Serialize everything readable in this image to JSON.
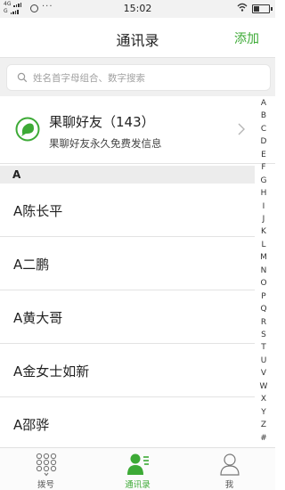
{
  "status_bar": {
    "network_1": "4G",
    "network_2": "G",
    "time": "15:02",
    "dots": "···"
  },
  "header": {
    "title": "通讯录",
    "add_label": "添加"
  },
  "search": {
    "placeholder": "姓名首字母组合、数字搜索"
  },
  "friends_card": {
    "title": "果聊好友（143）",
    "subtitle": "果聊好友永久免费发信息"
  },
  "index_letters": [
    "A",
    "B",
    "C",
    "D",
    "E",
    "F",
    "G",
    "H",
    "I",
    "J",
    "K",
    "L",
    "M",
    "N",
    "O",
    "P",
    "Q",
    "R",
    "S",
    "T",
    "U",
    "V",
    "W",
    "X",
    "Y",
    "Z",
    "#"
  ],
  "section": {
    "letter": "A"
  },
  "contacts": [
    {
      "name": "A陈长平"
    },
    {
      "name": "A二鹏"
    },
    {
      "name": "A黄大哥"
    },
    {
      "name": "A金女士如新"
    },
    {
      "name": "A邵骅"
    }
  ],
  "tabs": [
    {
      "label": "拨号",
      "icon": "dialpad-icon",
      "active": false
    },
    {
      "label": "通讯录",
      "icon": "contacts-icon",
      "active": true
    },
    {
      "label": "我",
      "icon": "profile-icon",
      "active": false
    }
  ],
  "colors": {
    "accent": "#3daa36",
    "header_bg": "#ffffff",
    "section_bg": "#ececec"
  }
}
